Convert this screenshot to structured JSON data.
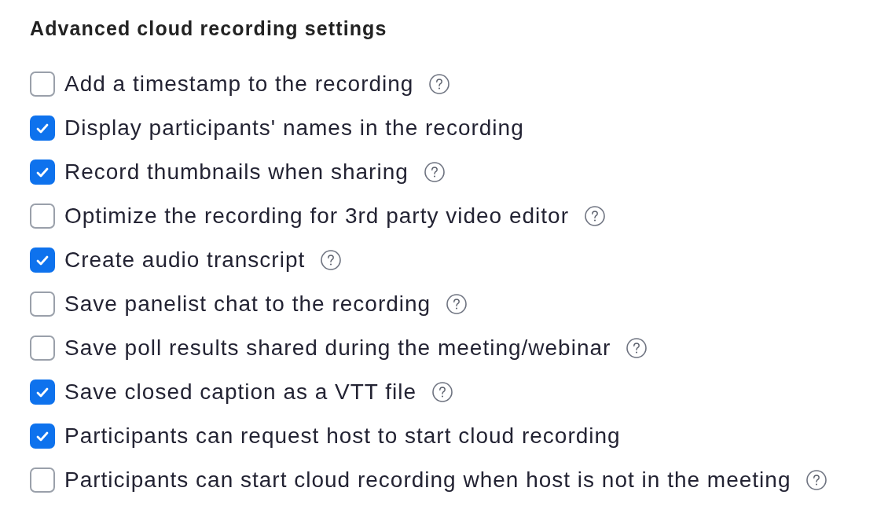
{
  "section": {
    "title": "Advanced cloud recording settings"
  },
  "options": [
    {
      "label": "Add a timestamp to the recording",
      "checked": false,
      "help": true
    },
    {
      "label": "Display participants' names in the recording",
      "checked": true,
      "help": false
    },
    {
      "label": "Record thumbnails when sharing",
      "checked": true,
      "help": true
    },
    {
      "label": "Optimize the recording for 3rd party video editor",
      "checked": false,
      "help": true
    },
    {
      "label": "Create audio transcript",
      "checked": true,
      "help": true
    },
    {
      "label": "Save panelist chat to the recording",
      "checked": false,
      "help": true
    },
    {
      "label": "Save poll results shared during the meeting/webinar",
      "checked": false,
      "help": true
    },
    {
      "label": "Save closed caption as a VTT file",
      "checked": true,
      "help": true
    },
    {
      "label": "Participants can request host to start cloud recording",
      "checked": true,
      "help": false
    },
    {
      "label": "Participants can start cloud recording when host is not in the meeting",
      "checked": false,
      "help": true
    }
  ]
}
